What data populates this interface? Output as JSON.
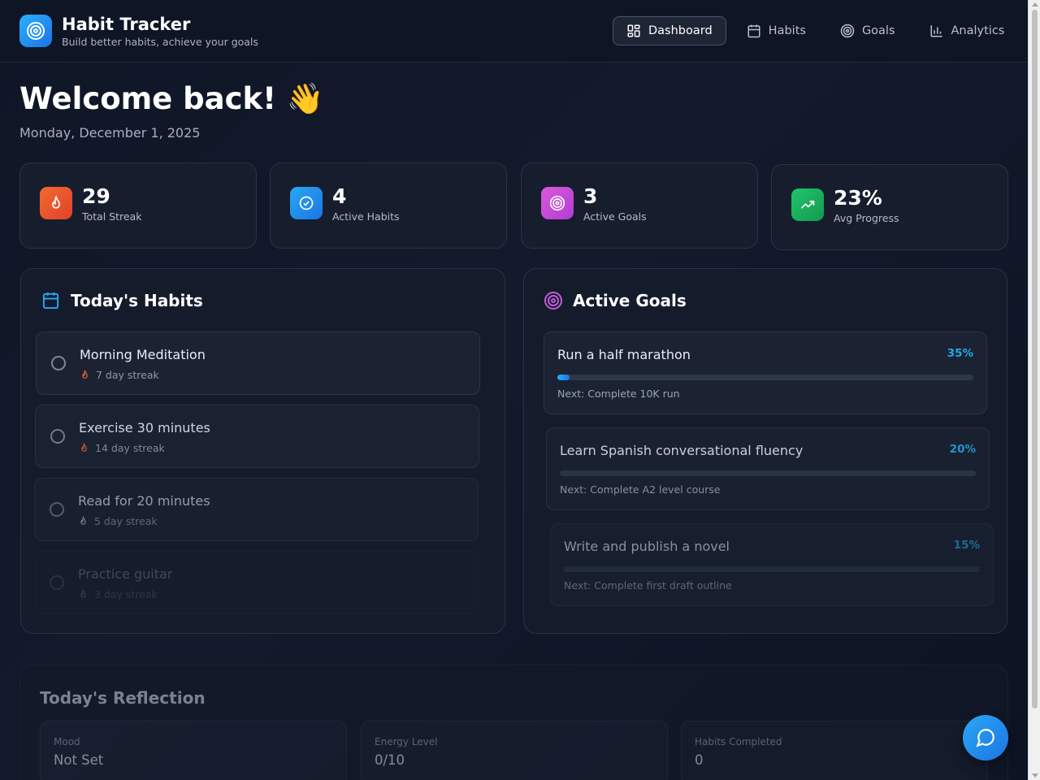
{
  "header": {
    "title": "Habit Tracker",
    "subtitle": "Build better habits, achieve your goals",
    "logo_icon": "target-icon",
    "nav": [
      {
        "label": "Dashboard",
        "icon": "dashboard-grid-icon",
        "active": true
      },
      {
        "label": "Habits",
        "icon": "calendar-icon",
        "active": false
      },
      {
        "label": "Goals",
        "icon": "target-icon",
        "active": false
      },
      {
        "label": "Analytics",
        "icon": "bar-chart-icon",
        "active": false
      }
    ]
  },
  "welcome": {
    "heading": "Welcome back! 👋",
    "date": "Monday, December 1, 2025"
  },
  "stats": [
    {
      "value": "29",
      "label": "Total Streak",
      "icon": "flame-icon",
      "color": "#f0532d"
    },
    {
      "value": "4",
      "label": "Active Habits",
      "icon": "check-circle-icon",
      "color": "#2196f3"
    },
    {
      "value": "3",
      "label": "Active Goals",
      "icon": "target-icon",
      "color": "#d046d4"
    },
    {
      "value": "23%",
      "label": "Avg Progress",
      "icon": "trending-up-icon",
      "color": "#18b35d"
    }
  ],
  "habits_panel": {
    "title": "Today's Habits",
    "items": [
      {
        "name": "Morning Meditation",
        "streak": "7 day streak"
      },
      {
        "name": "Exercise 30 minutes",
        "streak": "14 day streak"
      },
      {
        "name": "Read for 20 minutes",
        "streak": "5 day streak"
      },
      {
        "name": "Practice guitar",
        "streak": "3 day streak"
      }
    ]
  },
  "goals_panel": {
    "title": "Active Goals",
    "items": [
      {
        "name": "Run a half marathon",
        "percent": "35%",
        "progress": 0.03,
        "next": "Next: Complete 10K run"
      },
      {
        "name": "Learn Spanish conversational fluency",
        "percent": "20%",
        "progress": 0.0,
        "next": "Next: Complete A2 level course"
      },
      {
        "name": "Write and publish a novel",
        "percent": "15%",
        "progress": 0.0,
        "next": "Next: Complete first draft outline"
      }
    ]
  },
  "reflection": {
    "title": "Today's Reflection",
    "mood_label": "Mood",
    "mood_value": "Not Set",
    "energy_label": "Energy Level",
    "energy_value": "0/10",
    "completed_label": "Habits Completed",
    "completed_value": "0"
  },
  "colors": {
    "accent": "#25a9e8",
    "background": "#101828"
  }
}
